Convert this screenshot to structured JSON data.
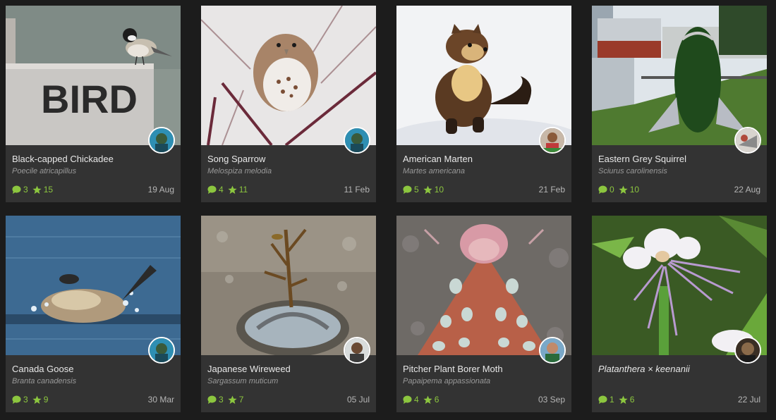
{
  "observations": [
    {
      "common_name": "Black-capped Chickadee",
      "scientific_name": "Poecile atricapillus",
      "comments": "3",
      "faves": "15",
      "date": "19 Aug",
      "sign_text": "BIRD"
    },
    {
      "common_name": "Song Sparrow",
      "scientific_name": "Melospiza melodia",
      "comments": "4",
      "faves": "11",
      "date": "11 Feb"
    },
    {
      "common_name": "American Marten",
      "scientific_name": "Martes americana",
      "comments": "5",
      "faves": "10",
      "date": "21 Feb"
    },
    {
      "common_name": "Eastern Grey Squirrel",
      "scientific_name": "Sciurus carolinensis",
      "comments": "0",
      "faves": "10",
      "date": "22 Aug"
    },
    {
      "common_name": "Canada Goose",
      "scientific_name": "Branta canadensis",
      "comments": "3",
      "faves": "9",
      "date": "30 Mar"
    },
    {
      "common_name": "Japanese Wireweed",
      "scientific_name": "Sargassum muticum",
      "comments": "3",
      "faves": "7",
      "date": "05 Jul"
    },
    {
      "common_name": "Pitcher Plant Borer Moth",
      "scientific_name": "Papaipema appassionata",
      "comments": "4",
      "faves": "6",
      "date": "03 Sep"
    },
    {
      "common_name": "Platanthera × keenanii",
      "scientific_name": "",
      "comments": "1",
      "faves": "6",
      "date": "22 Jul"
    }
  ],
  "colors": {
    "background": "#1c1c1c",
    "card": "#333333",
    "accent": "#8cc63f",
    "title": "#e8e8e8",
    "subtitle": "#9a9a9a"
  },
  "icons": {
    "comments": "speech-bubble-icon",
    "faves": "star-icon"
  }
}
